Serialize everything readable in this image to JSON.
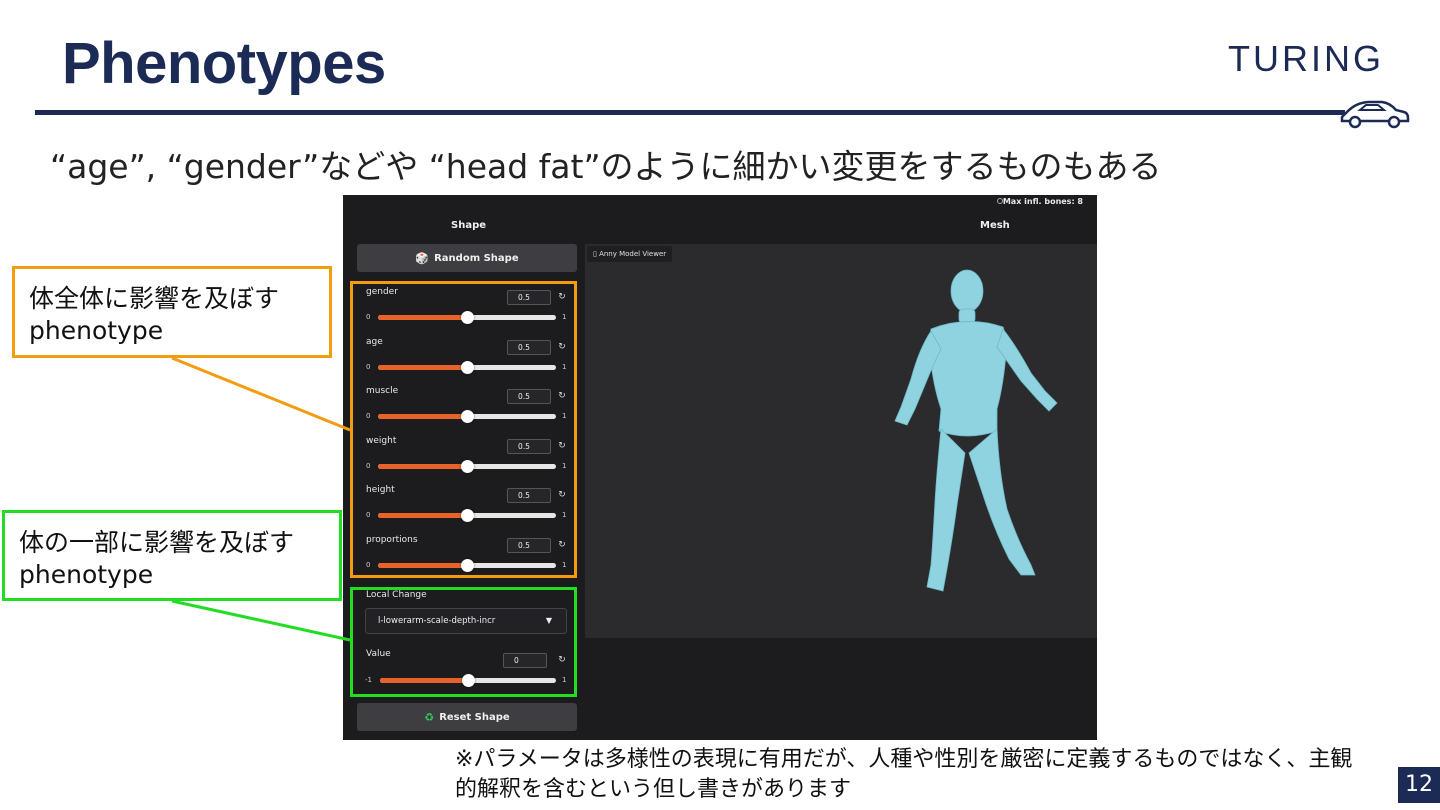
{
  "slide": {
    "title": "Phenotypes",
    "logo": "TURING",
    "subtitle": "“age”, “gender”などや “head fat”のように細かい変更をするものもある",
    "note": "※パラメータは多様性の表現に有用だが、人種や性別を厳密に定義するものではなく、主観的解釈を含むという但し書きがあります",
    "page_number": "12"
  },
  "callouts": {
    "global": {
      "line1": "体全体に影響を及ぼす",
      "line2": "phenotype"
    },
    "local": {
      "line1": "体の一部に影響を及ぼす",
      "line2": "phenotype"
    }
  },
  "app": {
    "info": "Max infl. bones: 8",
    "shape_panel_title": "Shape",
    "mesh_panel_title": "Mesh",
    "random_button": "Random Shape",
    "reset_button": "Reset Shape",
    "viewer_tab": "Anny Model Viewer",
    "sliders": [
      {
        "label": "gender",
        "value": "0.5",
        "min": "0",
        "max": "1",
        "fraction": 0.5
      },
      {
        "label": "age",
        "value": "0.5",
        "min": "0",
        "max": "1",
        "fraction": 0.5
      },
      {
        "label": "muscle",
        "value": "0.5",
        "min": "0",
        "max": "1",
        "fraction": 0.5
      },
      {
        "label": "weight",
        "value": "0.5",
        "min": "0",
        "max": "1",
        "fraction": 0.5
      },
      {
        "label": "height",
        "value": "0.5",
        "min": "0",
        "max": "1",
        "fraction": 0.5
      },
      {
        "label": "proportions",
        "value": "0.5",
        "min": "0",
        "max": "1",
        "fraction": 0.5
      }
    ],
    "local_change": {
      "label": "Local Change",
      "selected": "l-lowerarm-scale-depth-incr",
      "value_label": "Value",
      "value": "0",
      "min": "-1",
      "max": "1",
      "fraction": 0.5
    }
  },
  "colors": {
    "navy": "#1c2b55",
    "orange": "#f39c12",
    "green": "#22dd22",
    "slider_fill": "#e8632a",
    "mesh": "#8fd3e0"
  }
}
